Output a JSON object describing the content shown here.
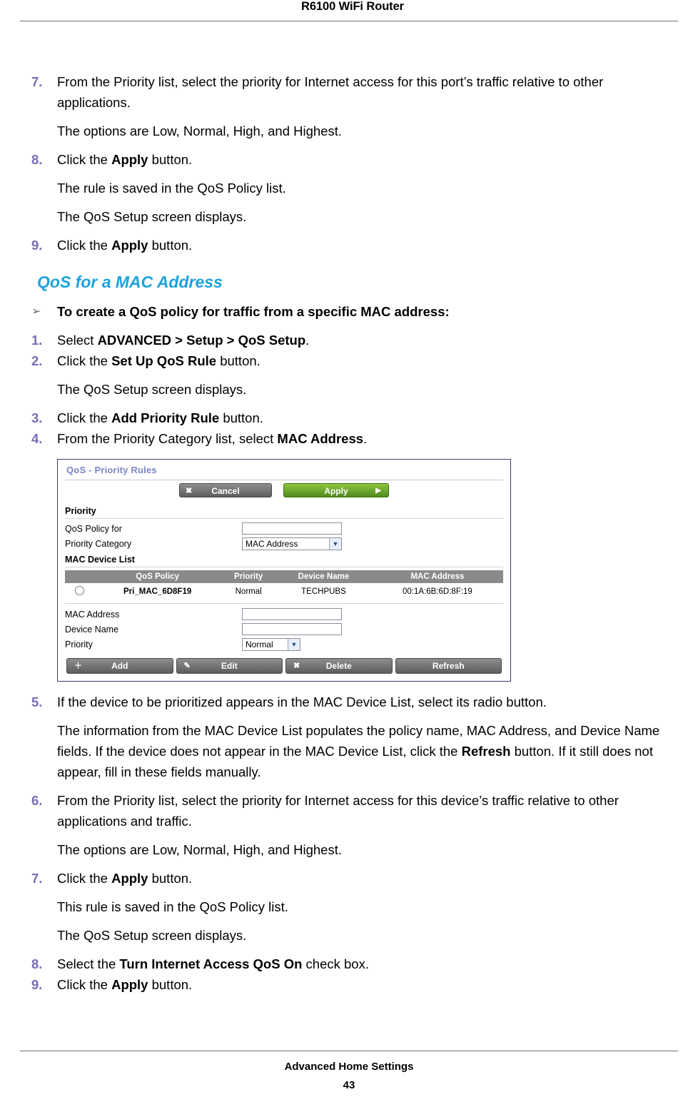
{
  "header": {
    "title": "R6100 WiFi Router"
  },
  "footer": {
    "section": "Advanced Home Settings",
    "page": "43"
  },
  "top_steps": [
    {
      "num": "7.",
      "text_pre": "From the Priority list, select the priority for Internet access for this port’s traffic relative to other applications.",
      "sub": "The options are Low, Normal, High, and Highest."
    },
    {
      "num": "8.",
      "text_pre": "Click the ",
      "bold": "Apply",
      "text_post": " button.",
      "sub": "The rule is saved in the QoS Policy list.",
      "sub2": "The QoS Setup screen displays."
    },
    {
      "num": "9.",
      "text_pre": "Click the ",
      "bold": "Apply",
      "text_post": " button."
    }
  ],
  "section": {
    "heading": "QoS for a MAC Address",
    "procedure_title": "To create a QoS policy for traffic from a specific MAC address:",
    "arrow": "➢"
  },
  "steps": [
    {
      "num": "1.",
      "pre": "Select ",
      "bold": "ADVANCED > Setup > QoS Setup",
      "post": "."
    },
    {
      "num": "2.",
      "pre": "Click the ",
      "bold": "Set Up QoS Rule",
      "post": " button.",
      "sub": "The QoS Setup screen displays."
    },
    {
      "num": "3.",
      "pre": "Click the ",
      "bold": "Add Priority Rule",
      "post": " button."
    },
    {
      "num": "4.",
      "pre": "From the Priority Category list, select ",
      "bold": "MAC Address",
      "post": "."
    }
  ],
  "figure": {
    "title": "QoS - Priority Rules",
    "cancel_label": "Cancel",
    "cancel_icon": "✖",
    "apply_label": "Apply",
    "apply_icon": "▶",
    "priority_section": "Priority",
    "fields": [
      {
        "label": "QoS Policy for",
        "value": ""
      },
      {
        "label": "Priority Category",
        "value": "MAC Address"
      }
    ],
    "device_list_section": "MAC Device List",
    "table": {
      "columns": [
        "QoS Policy",
        "Priority",
        "Device Name",
        "MAC Address"
      ],
      "rows": [
        {
          "selected": false,
          "policy": "Pri_MAC_6D8F19",
          "priority": "Normal",
          "device": "TECHPUBS",
          "mac": "00:1A:6B:6D:8F:19"
        }
      ]
    },
    "detail_fields": [
      {
        "label": "MAC Address",
        "value": ""
      },
      {
        "label": "Device Name",
        "value": ""
      },
      {
        "label": "Priority",
        "value": "Normal"
      }
    ],
    "bottom_buttons": [
      {
        "label": "Add",
        "icon": "＋"
      },
      {
        "label": "Edit",
        "icon": "✎"
      },
      {
        "label": "Delete",
        "icon": "✖"
      },
      {
        "label": "Refresh",
        "icon": ""
      }
    ]
  },
  "steps_after": [
    {
      "num": "5.",
      "text": "If the device to be prioritized appears in the MAC Device List, select its radio button.",
      "sub_a": "The information from the MAC Device List populates the policy name, MAC Address, and Device Name fields. If the device does not appear in the MAC Device List, click the ",
      "sub_b": "Refresh",
      "sub_c": " button. If it still does not appear, fill in these fields manually."
    },
    {
      "num": "6.",
      "text": "From the Priority list, select the priority for Internet access for this device’s traffic relative to other applications and traffic.",
      "sub": "The options are Low, Normal, High, and Highest."
    },
    {
      "num": "7.",
      "pre": "Click the ",
      "bold": "Apply",
      "post": " button.",
      "sub": "This rule is saved in the QoS Policy list.",
      "sub2": "The QoS Setup screen displays."
    },
    {
      "num": "8.",
      "pre": "Select the ",
      "bold": "Turn Internet Access QoS On",
      "post": " check box."
    },
    {
      "num": "9.",
      "pre": "Click the ",
      "bold": "Apply",
      "post": " button."
    }
  ]
}
